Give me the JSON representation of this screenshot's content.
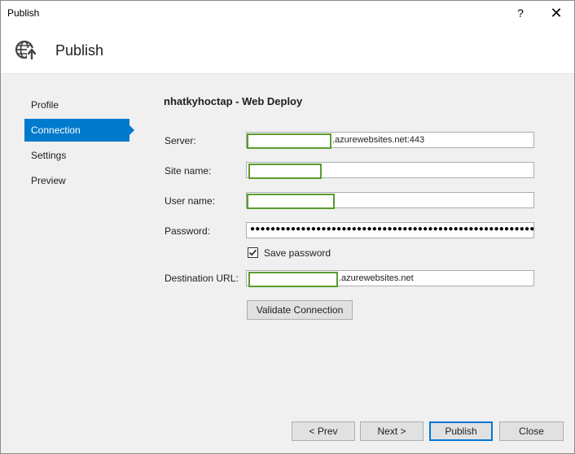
{
  "window": {
    "title": "Publish",
    "help_label": "?",
    "close_label": "✕"
  },
  "header": {
    "title": "Publish",
    "icon": "globe-publish-icon"
  },
  "nav": {
    "items": [
      {
        "label": "Profile"
      },
      {
        "label": "Connection"
      },
      {
        "label": "Settings"
      },
      {
        "label": "Preview"
      }
    ],
    "active": "Connection"
  },
  "content": {
    "title": "nhatkyhoctap - Web Deploy",
    "server": {
      "label": "Server:",
      "suffix": ".azurewebsites.net:443"
    },
    "site_name": {
      "label": "Site name:"
    },
    "user_name": {
      "label": "User name:"
    },
    "password": {
      "label": "Password:",
      "value": "●●●●●●●●●●●●●●●●●●●●●●●●●●●●●●●●●●●●●●●●●●●●●●●●●●●●●●●●●●"
    },
    "save_password": {
      "label": "Save password",
      "checked": true
    },
    "destination_url": {
      "label": "Destination URL:",
      "suffix": ".azurewebsites.net"
    },
    "validate_label": "Validate Connection"
  },
  "footer": {
    "prev_label": "< Prev",
    "next_label": "Next >",
    "publish_label": "Publish",
    "close_label": "Close"
  },
  "colors": {
    "accent": "#007acc",
    "mask_border": "#5a9c2c"
  }
}
